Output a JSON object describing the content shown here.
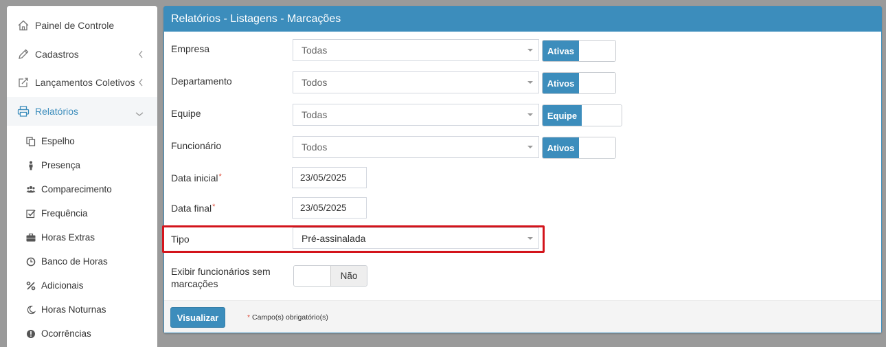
{
  "sidebar": {
    "items": [
      {
        "label": "Painel de Controle",
        "icon": "home-icon"
      },
      {
        "label": "Cadastros",
        "icon": "pencil-icon"
      },
      {
        "label": "Lançamentos Coletivos",
        "icon": "edit-share-icon"
      },
      {
        "label": "Relatórios",
        "icon": "printer-icon",
        "active": true
      }
    ],
    "sub_items": [
      {
        "label": "Espelho",
        "icon": "copy-icon"
      },
      {
        "label": "Presença",
        "icon": "person-icon"
      },
      {
        "label": "Comparecimento",
        "icon": "users-icon"
      },
      {
        "label": "Frequência",
        "icon": "check-square-icon"
      },
      {
        "label": "Horas Extras",
        "icon": "briefcase-icon"
      },
      {
        "label": "Banco de Horas",
        "icon": "clock-icon"
      },
      {
        "label": "Adicionais",
        "icon": "percent-icon"
      },
      {
        "label": "Horas Noturnas",
        "icon": "moon-icon"
      },
      {
        "label": "Ocorrências",
        "icon": "exclamation-circle-icon"
      }
    ]
  },
  "panel": {
    "title": "Relatórios - Listagens - Marcações",
    "fields": {
      "empresa": {
        "label": "Empresa",
        "value": "Todas",
        "toggle": "Ativas"
      },
      "departamento": {
        "label": "Departamento",
        "value": "Todos",
        "toggle": "Ativos"
      },
      "equipe": {
        "label": "Equipe",
        "value": "Todas",
        "toggle": "Equipe"
      },
      "funcionario": {
        "label": "Funcionário",
        "value": "Todos",
        "toggle": "Ativos"
      },
      "data_inicial": {
        "label": "Data inicial",
        "value": "23/05/2025",
        "required": "*"
      },
      "data_final": {
        "label": "Data final",
        "value": "23/05/2025",
        "required": "*"
      },
      "tipo": {
        "label": "Tipo",
        "value": "Pré-assinalada"
      },
      "exibir": {
        "label_line1": "Exibir funcionários sem",
        "label_line2": "marcações",
        "value": "Não"
      }
    },
    "footer": {
      "button": "Visualizar",
      "required_star": "*",
      "note": "Campo(s) obrigatório(s)"
    }
  },
  "colors": {
    "primary": "#3c8dbc",
    "highlight": "#d3141b",
    "required": "#dd4b39"
  }
}
